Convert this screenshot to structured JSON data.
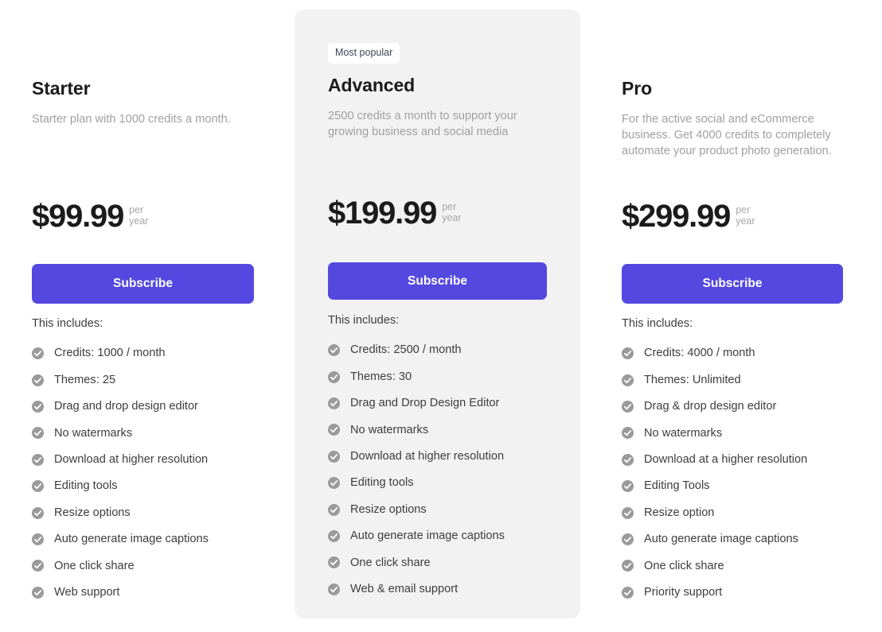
{
  "page": {
    "background": "#ffffff",
    "accent_color": "#5448e0",
    "card_background": "#f2f2f2",
    "check_icon_color": "#9a9a9a"
  },
  "plans": [
    {
      "id": "starter",
      "badge": null,
      "name": "Starter",
      "description": "Starter plan with 1000 credits a month.",
      "price": "$99.99",
      "period_line1": "per",
      "period_line2": "year",
      "cta_label": "Subscribe",
      "includes_label": "This includes:",
      "features": [
        "Credits: 1000 / month",
        "Themes: 25",
        "Drag and drop design editor",
        "No watermarks",
        "Download at higher resolution",
        "Editing tools",
        "Resize options",
        "Auto generate image captions",
        "One click share",
        "Web support"
      ]
    },
    {
      "id": "advanced",
      "badge": "Most popular",
      "name": "Advanced",
      "description": "2500 credits a month to support your growing business and social media",
      "price": "$199.99",
      "period_line1": "per",
      "period_line2": "year",
      "cta_label": "Subscribe",
      "includes_label": "This includes:",
      "features": [
        "Credits: 2500 / month",
        "Themes: 30",
        "Drag and Drop Design Editor",
        "No watermarks",
        "Download at higher resolution",
        "Editing tools",
        "Resize options",
        "Auto generate image captions",
        "One click share",
        "Web & email support"
      ]
    },
    {
      "id": "pro",
      "badge": null,
      "name": "Pro",
      "description": "For the active social and eCommerce business. Get 4000 credits to completely automate your product photo generation.",
      "price": "$299.99",
      "period_line1": "per",
      "period_line2": "year",
      "cta_label": "Subscribe",
      "includes_label": "This includes:",
      "features": [
        "Credits: 4000 / month",
        "Themes: Unlimited",
        "Drag & drop design editor",
        "No watermarks",
        "Download at a higher resolution",
        "Editing Tools",
        "Resize option",
        "Auto generate image captions",
        "One click share",
        "Priority support"
      ]
    }
  ]
}
